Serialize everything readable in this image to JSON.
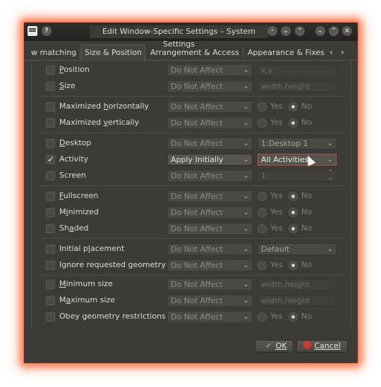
{
  "window": {
    "title": "Edit Window-Specific Settings – System Settings"
  },
  "tabs": [
    {
      "label": "w matching"
    },
    {
      "label": "Size & Position"
    },
    {
      "label": "Arrangement & Access"
    },
    {
      "label": "Appearance & Fixes"
    }
  ],
  "rows": {
    "position": {
      "label_pre": "",
      "label_u": "P",
      "label_post": "osition",
      "combo": "Do Not Affect",
      "value": "x,y"
    },
    "size": {
      "label_pre": "",
      "label_u": "S",
      "label_post": "ize",
      "combo": "Do Not Affect",
      "value": "width,height"
    },
    "max_h": {
      "label_pre": "Maximized ",
      "label_u": "h",
      "label_post": "orizontally",
      "combo": "Do Not Affect"
    },
    "max_v": {
      "label_pre": "Maximized ",
      "label_u": "v",
      "label_post": "ertically",
      "combo": "Do Not Affect"
    },
    "desktop": {
      "label_pre": "",
      "label_u": "D",
      "label_post": "esktop",
      "combo": "Do Not Affect",
      "value": "1:Desktop 1"
    },
    "activity": {
      "label": "Activity",
      "combo": "Apply Initially",
      "value": "All Activities"
    },
    "screen": {
      "label": "Screen",
      "combo": "Do Not Affect",
      "value": "1"
    },
    "fullscreen": {
      "label_pre": "",
      "label_u": "F",
      "label_post": "ullscreen",
      "combo": "Do Not Affect"
    },
    "minimized": {
      "label_pre": "M",
      "label_u": "i",
      "label_post": "nimized",
      "combo": "Do Not Affect"
    },
    "shaded": {
      "label_pre": "Sh",
      "label_u": "a",
      "label_post": "ded",
      "combo": "Do Not Affect"
    },
    "initial_placement": {
      "label_pre": "Initial p",
      "label_u": "l",
      "label_post": "acement",
      "combo": "Do Not Affect",
      "value": "Default"
    },
    "ignore_geometry": {
      "label_pre": "Ignore requested ",
      "label_u": "g",
      "label_post": "eometry",
      "combo": "Do Not Affect"
    },
    "min_size": {
      "label_pre": "",
      "label_u": "M",
      "label_post": "inimum size",
      "combo": "Do Not Affect",
      "value": "width,height"
    },
    "max_size": {
      "label_pre": "M",
      "label_u": "a",
      "label_post": "ximum size",
      "combo": "Do Not Affect",
      "value": "width,height"
    },
    "obey_geometry": {
      "label": "Obey geometry restrictions",
      "combo": "Do Not Affect"
    }
  },
  "radio": {
    "yes": "Yes",
    "no": "No"
  },
  "buttons": {
    "ok": "OK",
    "cancel": "Cancel"
  },
  "colors": {
    "glow": "#ff6a3d",
    "window_bg": "#3c3b37",
    "cancel_icon": "#d9362b"
  }
}
